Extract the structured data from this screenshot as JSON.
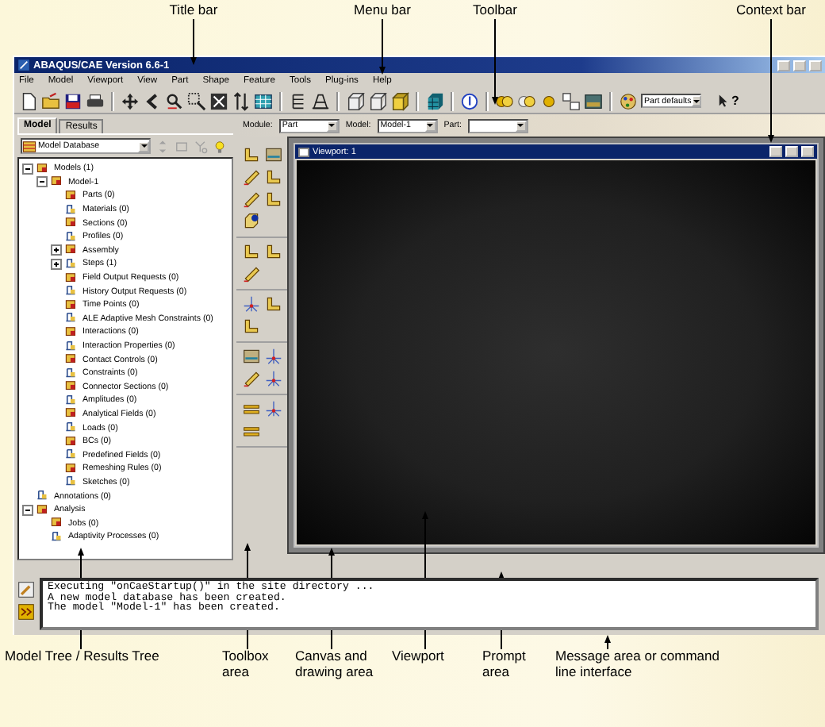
{
  "annotations": {
    "top": [
      "Title bar",
      "Menu bar",
      "Toolbar",
      "Context bar"
    ],
    "bottom": [
      "Model Tree / Results Tree",
      "Toolbox area",
      "Canvas and drawing area",
      "Viewport",
      "Prompt area",
      "Message area or command line interface"
    ]
  },
  "window": {
    "title": "ABAQUS/CAE Version 6.6-1"
  },
  "menu": [
    "File",
    "Model",
    "Viewport",
    "View",
    "Part",
    "Shape",
    "Feature",
    "Tools",
    "Plug-ins",
    "Help"
  ],
  "toolbar": {
    "render_combo": "Part defaults",
    "help_label": "?"
  },
  "left_panel": {
    "tabs": [
      {
        "label": "Model",
        "selected": true
      },
      {
        "label": "Results",
        "selected": false
      }
    ],
    "source": "Model Database",
    "tree": [
      {
        "label": "Models (1)",
        "expanded": true,
        "children": [
          {
            "label": "Model-1",
            "expanded": true,
            "children": [
              {
                "label": "Parts (0)"
              },
              {
                "label": "Materials (0)"
              },
              {
                "label": "Sections (0)"
              },
              {
                "label": "Profiles (0)"
              },
              {
                "label": "Assembly",
                "expanded": false
              },
              {
                "label": "Steps (1)",
                "expanded": false
              },
              {
                "label": "Field Output Requests (0)"
              },
              {
                "label": "History Output Requests (0)"
              },
              {
                "label": "Time Points (0)"
              },
              {
                "label": "ALE Adaptive Mesh Constraints (0)"
              },
              {
                "label": "Interactions (0)"
              },
              {
                "label": "Interaction Properties (0)"
              },
              {
                "label": "Contact Controls (0)"
              },
              {
                "label": "Constraints (0)"
              },
              {
                "label": "Connector Sections (0)"
              },
              {
                "label": "Amplitudes (0)"
              },
              {
                "label": "Analytical Fields (0)"
              },
              {
                "label": "Loads (0)"
              },
              {
                "label": "BCs (0)"
              },
              {
                "label": "Predefined Fields (0)"
              },
              {
                "label": "Remeshing Rules (0)"
              },
              {
                "label": "Sketches (0)"
              }
            ]
          }
        ]
      },
      {
        "label": "Annotations (0)"
      },
      {
        "label": "Analysis",
        "expanded": true,
        "children": [
          {
            "label": "Jobs (0)"
          },
          {
            "label": "Adaptivity Processes (0)"
          }
        ]
      }
    ]
  },
  "context_bar": [
    {
      "label": "Module:",
      "value": "Part"
    },
    {
      "label": "Model:",
      "value": "Model-1"
    },
    {
      "label": "Part:"
    }
  ],
  "viewport": {
    "title": "Viewport: 1"
  },
  "messages": [
    "Executing \"onCaeStartup()\" in the site directory ...",
    "A new model database has been created.",
    "The model \"Model-1\" has been created."
  ]
}
